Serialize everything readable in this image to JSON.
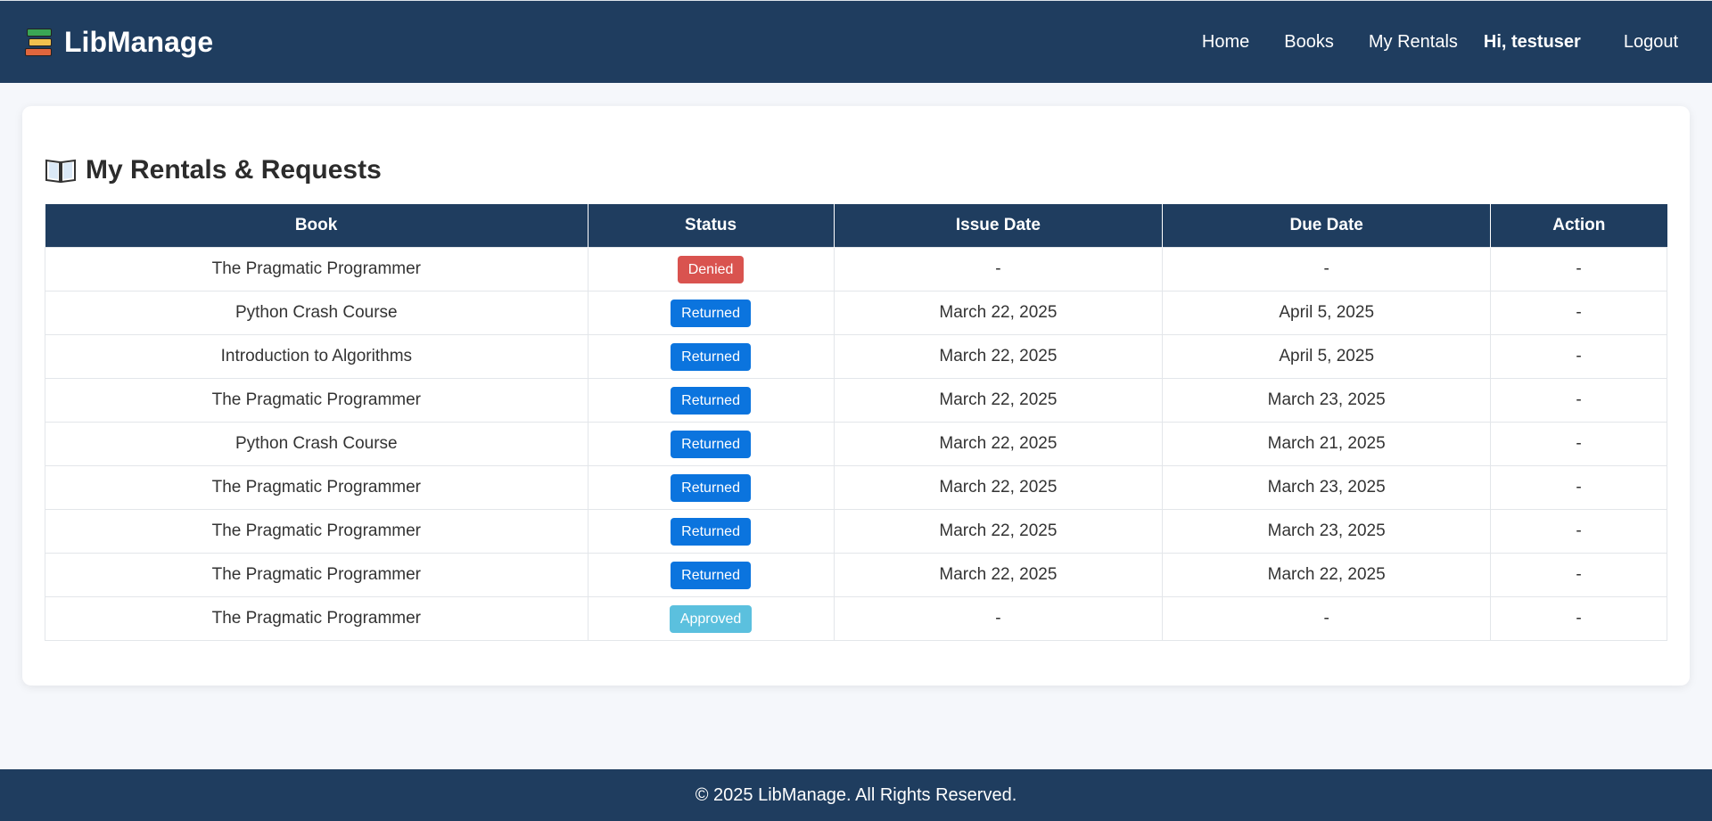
{
  "nav": {
    "brand": "LibManage",
    "brand_icon": "books-stack-icon",
    "links": [
      "Home",
      "Books",
      "My Rentals"
    ],
    "user_greeting": "Hi, testuser",
    "logout": "Logout"
  },
  "main": {
    "title": "My Rentals & Requests",
    "title_icon": "open-book-icon",
    "table": {
      "columns": [
        "Book",
        "Status",
        "Issue Date",
        "Due Date",
        "Action"
      ],
      "rows": [
        {
          "book": "The Pragmatic Programmer",
          "status": "Denied",
          "issue_date": "-",
          "due_date": "-",
          "action": "-"
        },
        {
          "book": "Python Crash Course",
          "status": "Returned",
          "issue_date": "March 22, 2025",
          "due_date": "April 5, 2025",
          "action": "-"
        },
        {
          "book": "Introduction to Algorithms",
          "status": "Returned",
          "issue_date": "March 22, 2025",
          "due_date": "April 5, 2025",
          "action": "-"
        },
        {
          "book": "The Pragmatic Programmer",
          "status": "Returned",
          "issue_date": "March 22, 2025",
          "due_date": "March 23, 2025",
          "action": "-"
        },
        {
          "book": "Python Crash Course",
          "status": "Returned",
          "issue_date": "March 22, 2025",
          "due_date": "March 21, 2025",
          "action": "-"
        },
        {
          "book": "The Pragmatic Programmer",
          "status": "Returned",
          "issue_date": "March 22, 2025",
          "due_date": "March 23, 2025",
          "action": "-"
        },
        {
          "book": "The Pragmatic Programmer",
          "status": "Returned",
          "issue_date": "March 22, 2025",
          "due_date": "March 23, 2025",
          "action": "-"
        },
        {
          "book": "The Pragmatic Programmer",
          "status": "Returned",
          "issue_date": "March 22, 2025",
          "due_date": "March 22, 2025",
          "action": "-"
        },
        {
          "book": "The Pragmatic Programmer",
          "status": "Approved",
          "issue_date": "-",
          "due_date": "-",
          "action": "-"
        }
      ]
    }
  },
  "status_colors": {
    "Denied": "#d9534f",
    "Returned": "#0b74de",
    "Approved": "#5bc0de"
  },
  "colors": {
    "primary": "#1f3d5f",
    "background": "#f5f7fb"
  },
  "footer": {
    "text": "© 2025 LibManage. All Rights Reserved."
  }
}
